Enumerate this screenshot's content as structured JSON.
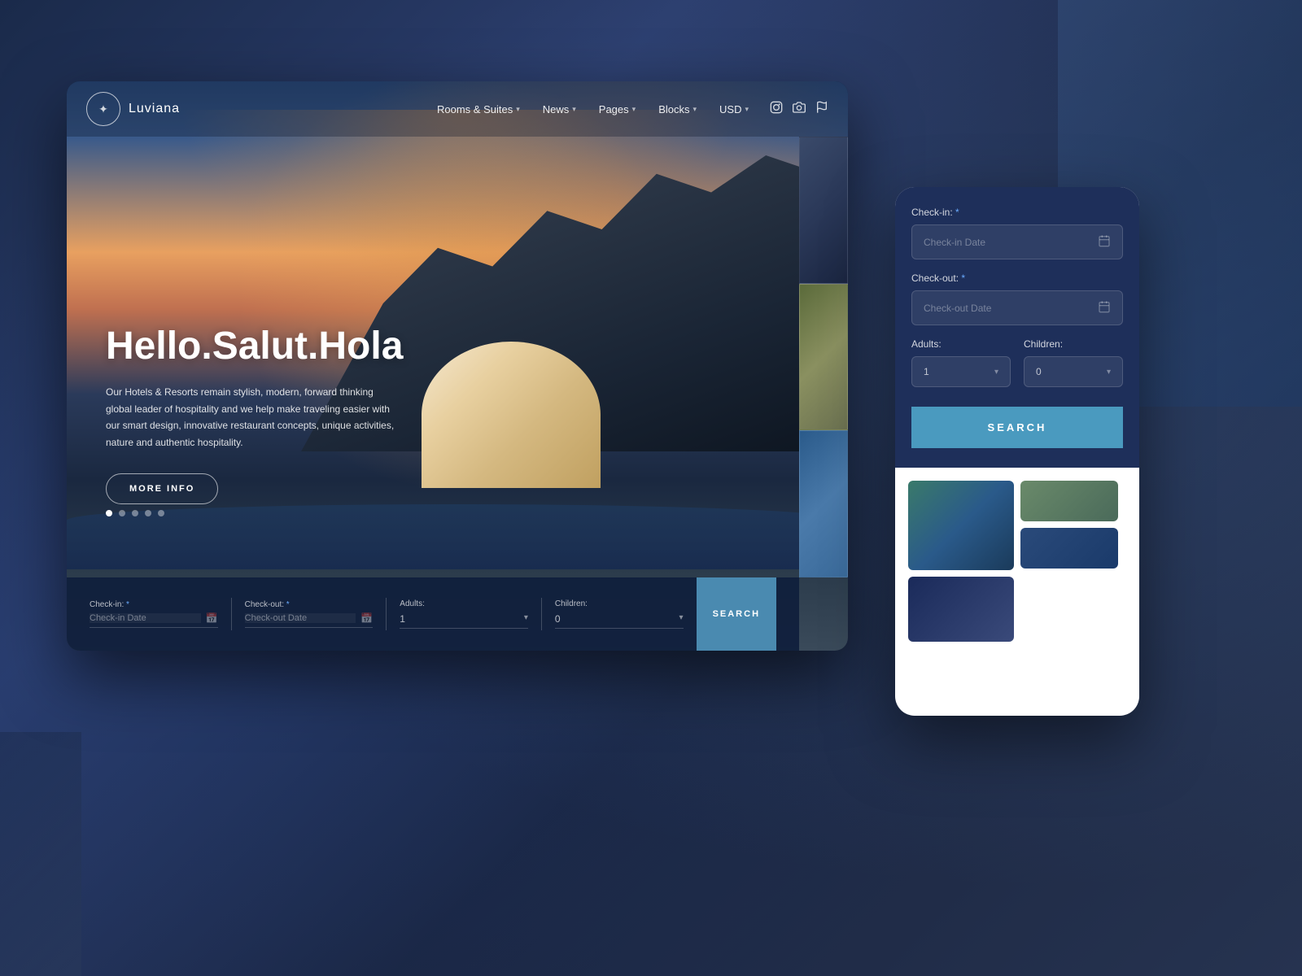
{
  "background": {
    "color": "#1a2540"
  },
  "desktop": {
    "logo": {
      "icon": "✦",
      "name": "Luviana"
    },
    "nav": {
      "items": [
        {
          "label": "Rooms & Suites",
          "hasDropdown": true
        },
        {
          "label": "News",
          "hasDropdown": true
        },
        {
          "label": "Pages",
          "hasDropdown": true
        },
        {
          "label": "Blocks",
          "hasDropdown": true
        },
        {
          "label": "USD",
          "hasDropdown": true
        }
      ],
      "icons": [
        "instagram",
        "camera",
        "flag"
      ]
    },
    "hero": {
      "title": "Hello.Salut.Hola",
      "subtitle": "Our Hotels & Resorts remain stylish, modern, forward thinking global leader of hospitality and we help make traveling easier with our smart design, innovative restaurant concepts, unique activities, nature and authentic hospitality.",
      "cta": "MORE INFO",
      "dots": [
        true,
        false,
        false,
        false,
        false
      ]
    },
    "searchBar": {
      "checkIn": {
        "label": "Check-in:",
        "required": "*",
        "placeholder": "Check-in Date"
      },
      "checkOut": {
        "label": "Check-out:",
        "required": "*",
        "placeholder": "Check-out Date"
      },
      "adults": {
        "label": "Adults:",
        "value": "1"
      },
      "children": {
        "label": "Children:",
        "value": "0"
      },
      "searchBtn": "SEARCH"
    }
  },
  "mobile": {
    "booking": {
      "checkIn": {
        "label": "Check-in:",
        "required": "*",
        "placeholder": "Check-in Date"
      },
      "checkOut": {
        "label": "Check-out:",
        "required": "*",
        "placeholder": "Check-out Date"
      },
      "adults": {
        "label": "Adults:",
        "value": "1"
      },
      "children": {
        "label": "Children:",
        "value": "0"
      },
      "searchBtn": "SEARCH"
    }
  }
}
